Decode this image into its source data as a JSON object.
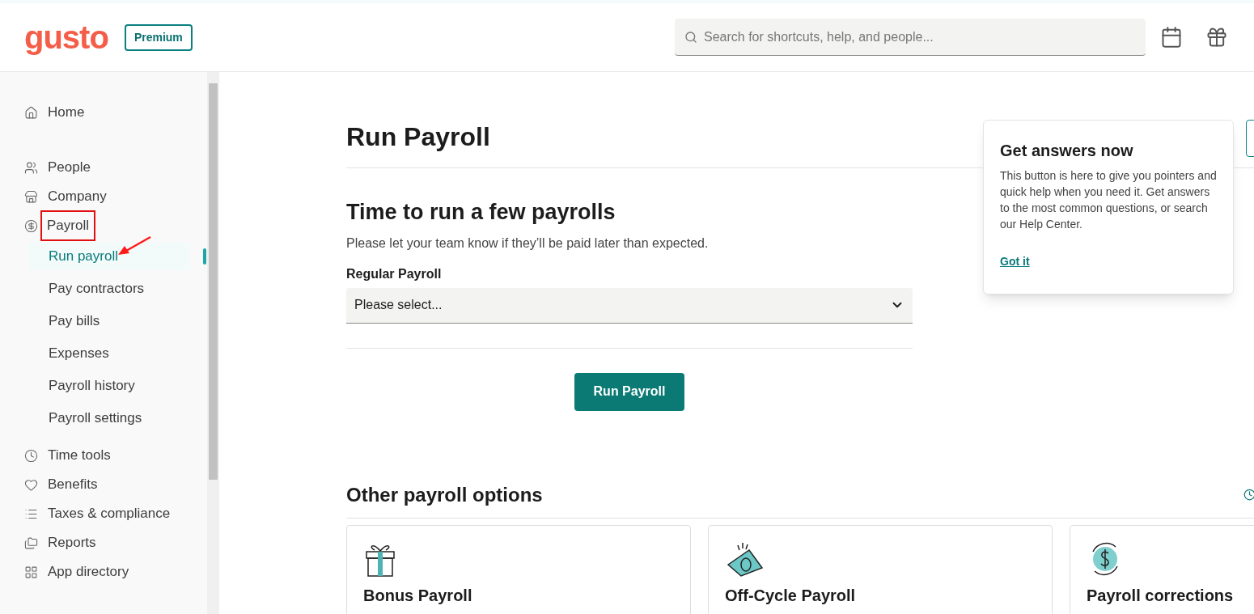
{
  "header": {
    "logo": "gusto",
    "plan_badge": "Premium",
    "search": {
      "placeholder": "Search for shortcuts, help, and people..."
    }
  },
  "sidebar": {
    "groups": [
      [
        {
          "label": "Home",
          "selected": false,
          "highlighted": false
        }
      ],
      [
        {
          "label": "People",
          "selected": false,
          "highlighted": false
        },
        {
          "label": "Company",
          "selected": false,
          "highlighted": false
        },
        {
          "label": "Payroll",
          "selected": false,
          "highlighted": true,
          "children": [
            {
              "label": "Run payroll",
              "selected": true,
              "pointed": true
            },
            {
              "label": "Pay contractors",
              "selected": false,
              "pointed": false
            },
            {
              "label": "Pay bills",
              "selected": false,
              "pointed": false
            },
            {
              "label": "Expenses",
              "selected": false,
              "pointed": false
            },
            {
              "label": "Payroll history",
              "selected": false,
              "pointed": false
            },
            {
              "label": "Payroll settings",
              "selected": false,
              "pointed": false
            }
          ]
        },
        {
          "label": "Time tools",
          "selected": false,
          "highlighted": false
        },
        {
          "label": "Benefits",
          "selected": false,
          "highlighted": false
        },
        {
          "label": "Taxes & compliance",
          "selected": false,
          "highlighted": false
        },
        {
          "label": "Reports",
          "selected": false,
          "highlighted": false
        },
        {
          "label": "App directory",
          "selected": false,
          "highlighted": false
        }
      ]
    ]
  },
  "main": {
    "title": "Run Payroll",
    "section": {
      "heading": "Time to run a few payrolls",
      "subtext": "Please let your team know if they’ll be paid later than expected.",
      "field_label": "Regular Payroll",
      "select": {
        "value": "Please select..."
      },
      "button": "Run Payroll"
    },
    "other": {
      "heading": "Other payroll options",
      "cards": [
        {
          "title": "Bonus Payroll"
        },
        {
          "title": "Off-Cycle Payroll"
        },
        {
          "title": "Payroll corrections"
        }
      ]
    }
  },
  "popover": {
    "title": "Get answers now",
    "body": "This button is here to give you pointers and quick help when you need it. Get answers to the most common questions, or search our Help Center.",
    "link": "Got it"
  }
}
